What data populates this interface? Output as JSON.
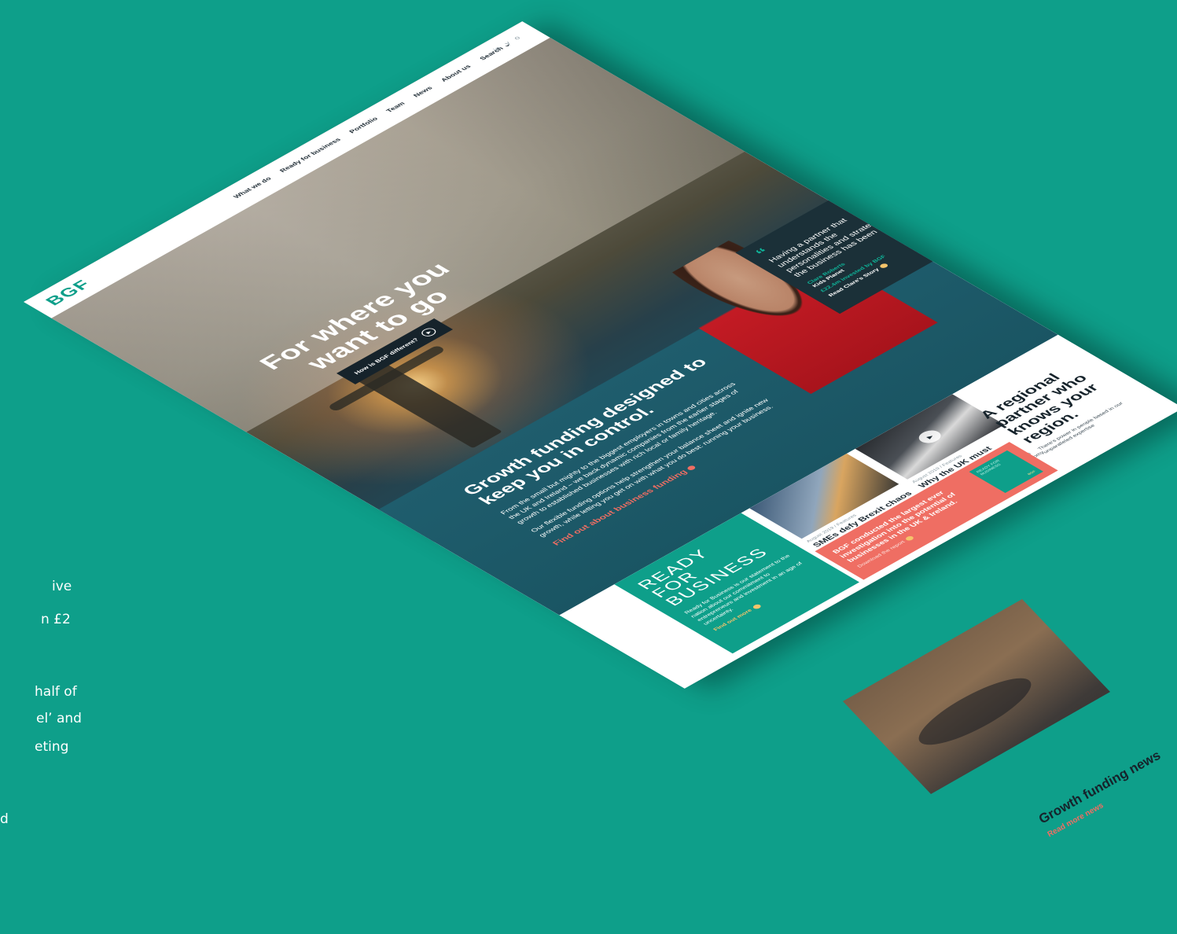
{
  "side_text": [
    "ive",
    "n £2",
    "half of",
    "el’ and",
    "eting",
    "d"
  ],
  "nav": {
    "logo": "BGF",
    "links": [
      "What we do",
      "Ready for business",
      "Portfolio",
      "Team",
      "News",
      "About us",
      "Search ⌄"
    ],
    "icons": [
      "in",
      "y",
      "o"
    ]
  },
  "hero": {
    "title": "For where you want to go",
    "button_label": "How is BGF different?"
  },
  "growth": {
    "title": "Growth funding designed to keep you in control.",
    "para1": "From the small but mighty to the biggest employers in towns and cities across the UK and Ireland – we back dynamic companies from the earlier stages of growth to established businesses with rich local or family heritage.",
    "para2": "Our flexible funding options help strengthen your balance sheet and ignite new growth, while letting you get on with what you do best: running your business.",
    "link": "Find out about business funding"
  },
  "quote": {
    "text": "Having a partner that understands the personalities and strategy of the business has been great",
    "name": "Clare Roberts",
    "company": "Kids Planet",
    "invested": "£22.4m invested by BGF",
    "link": "Read Clare's Story",
    "logo": "Kids Planet"
  },
  "rfb": {
    "big": "READY FOR BUSINESS",
    "body": "Ready for Business is our statement to the nation about our commitment to entrepreneurs and investment in an age of uncertainty.",
    "link": "Find out more"
  },
  "articles": [
    {
      "meta": "August 2019 / Features",
      "title": "SMEs defy Brexit chaos with £44bn revenue growth",
      "desc": "Despite prolonged uncertainty, SME's are boosting jobs and revenue in the UK."
    },
    {
      "meta": "August 2019 / Features",
      "title": "Why the UK must remain ready for business",
      "desc": "The real tragedy of Brexit is that it has distracted from the health of the economy."
    }
  ],
  "report": {
    "text": "BGF conducted the largest ever investigation into the potential of businesses in the UK & Ireland.",
    "link": "Download the report",
    "cover": "READY FOR BUSINESS",
    "cover_small": "BGF"
  },
  "regional": {
    "title": "A regional partner who knows your region.",
    "text": "There's power in people based in our unparalleled expertise"
  },
  "news": {
    "title": "Growth funding news",
    "link": "Read more news"
  },
  "colors": {
    "background": "#0e9f8a",
    "teal": "#0e9f8a",
    "coral": "#ef6e63",
    "dark": "#16232b"
  }
}
